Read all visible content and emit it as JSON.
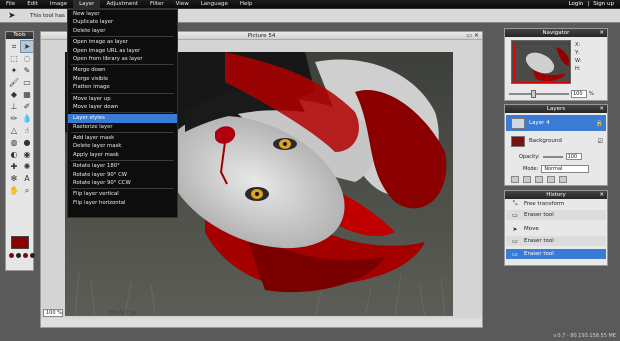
{
  "menubar": {
    "items": [
      "File",
      "Edit",
      "Image",
      "Layer",
      "Adjustment",
      "Filter",
      "View",
      "Language",
      "Help"
    ],
    "right": [
      "Login",
      "|",
      "Sign up"
    ]
  },
  "hint": {
    "text": "This tool has no"
  },
  "tools": {
    "title": "Tools"
  },
  "canvas": {
    "title": "Picture 54",
    "zoom": "100",
    "zoom_unit": "%",
    "dimensions": "793x527 px"
  },
  "layer_menu": {
    "groups": [
      [
        "New layer",
        "Duplicate layer",
        "Delete layer"
      ],
      [
        "Open image as layer",
        "Open image URL as layer",
        "Open from library as layer"
      ],
      [
        "Merge down",
        "Merge visible",
        "Flatten image"
      ],
      [
        "Move layer up",
        "Move layer down"
      ],
      [
        "Layer styles",
        "Rasterize layer"
      ],
      [
        "Add layer mask",
        "Delete layer mask",
        "Apply layer mask"
      ],
      [
        "Rotate layer 180°",
        "Rotate layer 90° CW",
        "Rotate layer 90° CCW"
      ],
      [
        "Flip layer vertical",
        "Flip layer horizontal"
      ]
    ],
    "highlighted": "Layer styles"
  },
  "navigator": {
    "title": "Navigator",
    "x_label": "X:",
    "y_label": "Y:",
    "w_label": "W:",
    "h_label": "H:",
    "zoom": "100",
    "zoom_unit": "%"
  },
  "layers": {
    "title": "Layers",
    "items": [
      {
        "name": "Layer 4"
      },
      {
        "name": "Background"
      }
    ],
    "opacity_label": "Opacity:",
    "opacity_value": "100",
    "mode_label": "Mode:",
    "mode_value": "Normal"
  },
  "history": {
    "title": "History",
    "items": [
      "Free transform",
      "Eraser tool",
      "Move",
      "Eraser tool",
      "Eraser tool"
    ]
  },
  "version": "v.0.7 - 80.193.158.55 ME",
  "colors": {
    "accent": "#3a7bd5",
    "foreground": "#8c0000",
    "menu_bg": "#0d0d0d"
  }
}
